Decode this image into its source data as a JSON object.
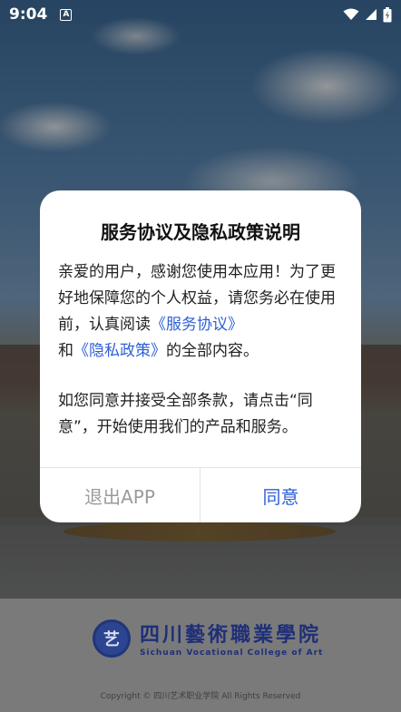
{
  "status_bar": {
    "time": "9:04",
    "a_badge": "A",
    "icons": [
      "wifi-icon",
      "signal-icon",
      "battery-charging-icon"
    ]
  },
  "dialog": {
    "title": "服务协议及隐私政策说明",
    "p1_text1": "亲爱的用户，感谢您使用本应用！为了更好地保障您的个人权益，请您务必在使用前，认真阅读",
    "p1_link1": "《服务协议》",
    "p1_and": "和",
    "p1_link2": "《隐私政策》",
    "p1_text2": "的全部内容。",
    "p2_text": "如您同意并接受全部条款，请点击“同意”，开始使用我们的产品和服务。",
    "exit_label": "退出APP",
    "agree_label": "同意"
  },
  "footer": {
    "logo_cn": "四川藝術職業學院",
    "logo_en": "Sichuan Vocational College of Art",
    "logo_mark": "艺",
    "copyright": "Copyright © 四川艺术职业学院 All Rights Reserved"
  },
  "colors": {
    "link": "#2d5fd6",
    "exit_text": "#9b9b9b",
    "brand_blue": "#1f2f78"
  }
}
